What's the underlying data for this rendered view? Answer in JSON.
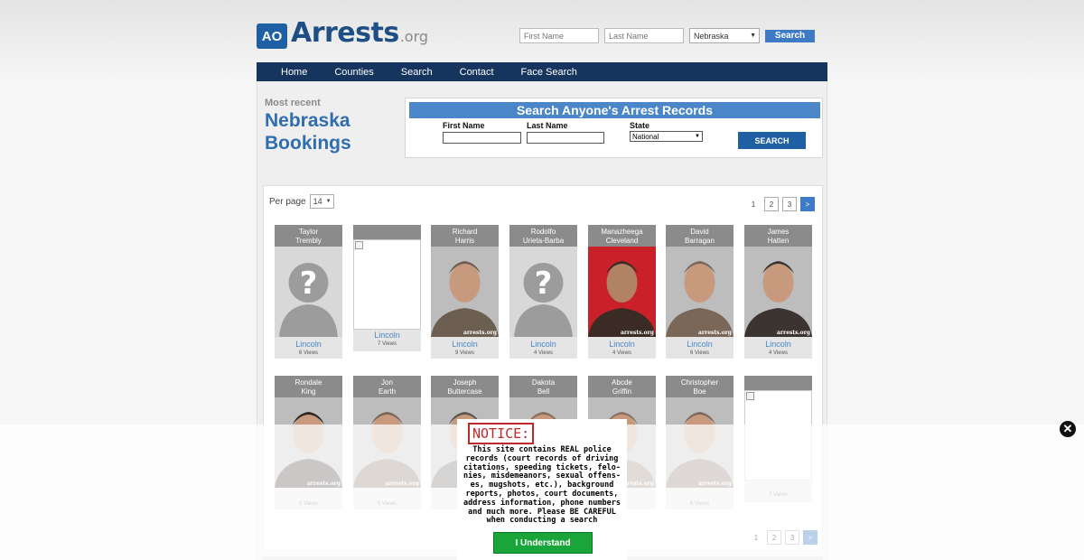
{
  "header": {
    "logo_text": "Arrests",
    "logo_suffix": ".org",
    "logo_mark": "AO",
    "first_name_placeholder": "First Name",
    "last_name_placeholder": "Last Name",
    "state_selected": "Nebraska",
    "search_label": "Search"
  },
  "nav": [
    "Home",
    "Counties",
    "Search",
    "Contact",
    "Face Search"
  ],
  "recent": {
    "small": "Most recent",
    "line1": "Nebraska",
    "line2": "Bookings"
  },
  "search_box": {
    "title": "Search Anyone's Arrest Records",
    "first_label": "First Name",
    "last_label": "Last Name",
    "state_label": "State",
    "state_selected": "National",
    "button": "SEARCH"
  },
  "listing": {
    "per_page_label": "Per page",
    "per_page_value": "14",
    "pages": [
      "1",
      "2",
      "3",
      ">"
    ],
    "cards": [
      {
        "first": "Taylor",
        "last": "Trembly",
        "city": "Lincoln",
        "views": "6 Views"
      },
      {
        "first": "",
        "last": "",
        "city": "Lincoln",
        "views": "7 Views"
      },
      {
        "first": "Richard",
        "last": "Harris",
        "city": "Lincoln",
        "views": "9 Views"
      },
      {
        "first": "Rodolfo",
        "last": "Urieta-Barba",
        "city": "Lincoln",
        "views": "4 Views"
      },
      {
        "first": "Manazheega",
        "last": "Cleveland",
        "city": "Lincoln",
        "views": "4 Views"
      },
      {
        "first": "David",
        "last": "Barragan",
        "city": "Lincoln",
        "views": "6 Views"
      },
      {
        "first": "James",
        "last": "Hatten",
        "city": "Lincoln",
        "views": "4 Views"
      },
      {
        "first": "Rondale",
        "last": "King",
        "city": "",
        "views": "5 Views"
      },
      {
        "first": "Jon",
        "last": "Earth",
        "city": "",
        "views": "5 Views"
      },
      {
        "first": "Joseph",
        "last": "Buttercase",
        "city": "",
        "views": ""
      },
      {
        "first": "Dakota",
        "last": "Bell",
        "city": "",
        "views": ""
      },
      {
        "first": "Abcde",
        "last": "Griffin",
        "city": "",
        "views": ""
      },
      {
        "first": "Christopher",
        "last": "Boe",
        "city": "",
        "views": "6 Views"
      },
      {
        "first": "",
        "last": "",
        "city": "",
        "views": "7 Views"
      }
    ],
    "watermark": "arrests.org"
  },
  "notice": {
    "title": "NOTICE:",
    "body": "This site contains REAL police records (court records of driving citations, speeding tickets, felo-nies, misdemeanors, sexual offens-es, mugshots, etc.), background reports, photos, court documents, address information, phone numbers and much more. Please BE CAREFUL when conducting a search",
    "button": "I Understand"
  },
  "close_label": "✕",
  "colors": {
    "brand": "#1d4f86",
    "nav": "#15355f",
    "accent": "#4a86c8",
    "notice_red": "#c0292b",
    "ok_green": "#1aa53a"
  },
  "icons": [
    "unknown-silhouette-icon",
    "broken-image-icon",
    "close-icon",
    "select-chevron-icon"
  ]
}
